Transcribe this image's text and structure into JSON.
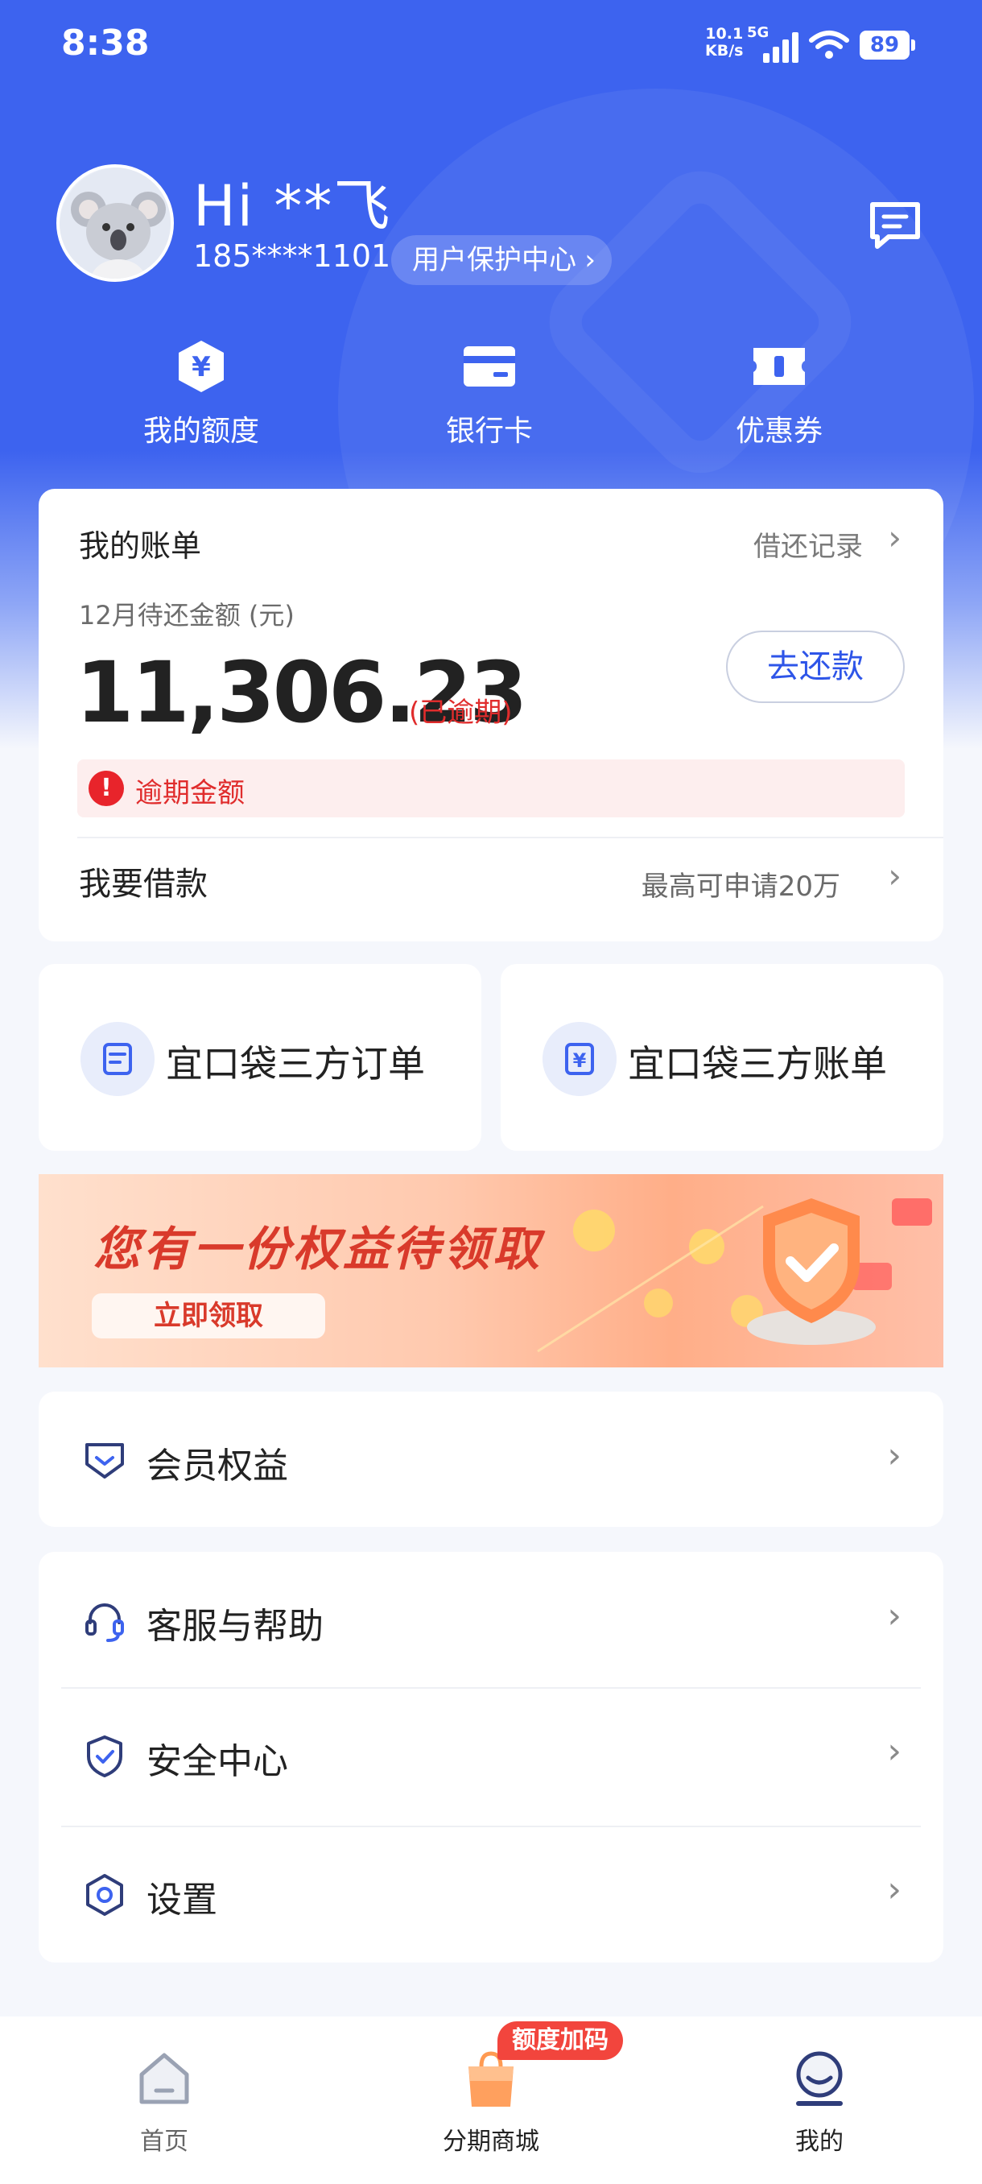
{
  "status_bar": {
    "time": "8:38",
    "net_speed_value": "10.1",
    "net_speed_unit": "KB/s",
    "network_type": "5G",
    "battery": "89"
  },
  "profile": {
    "greeting": "Hi **飞",
    "phone": "185****1101",
    "protect_center": "用户保护中心"
  },
  "quick_actions": [
    {
      "label": "我的额度",
      "icon": "yuan-hexagon-icon"
    },
    {
      "label": "银行卡",
      "icon": "bank-card-icon"
    },
    {
      "label": "优惠券",
      "icon": "coupon-icon"
    }
  ],
  "bill": {
    "title": "我的账单",
    "history_link": "借还记录",
    "due_label": "12月待还金额 (元)",
    "amount": "11,306.23",
    "overdue_tag": "(已逾期)",
    "repay_button": "去还款",
    "overdue_notice": "逾期金额",
    "borrow_title": "我要借款",
    "borrow_note": "最高可申请20万"
  },
  "third_party": [
    {
      "label": "宜口袋三方订单",
      "icon": "order-doc-icon"
    },
    {
      "label": "宜口袋三方账单",
      "icon": "yuan-bill-icon"
    }
  ],
  "banner": {
    "title": "您有一份权益待领取",
    "button": "立即领取"
  },
  "menu": {
    "member": "会员权益",
    "service": "客服与帮助",
    "security": "安全中心",
    "settings": "设置"
  },
  "tabbar": {
    "home": "首页",
    "mall": "分期商城",
    "mine": "我的",
    "promo_badge": "额度加码"
  },
  "colors": {
    "primary": "#3d63ef",
    "danger": "#e02c2c",
    "background": "#f5f7fc"
  }
}
